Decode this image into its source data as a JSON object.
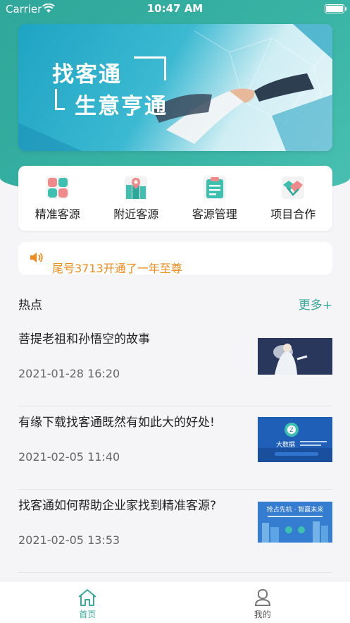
{
  "status_bar": {
    "carrier": "Carrier",
    "time": "10:47 AM"
  },
  "banner": {
    "line1": "找客通",
    "line2": "生意亨通"
  },
  "menu": [
    {
      "label": "精准客源",
      "icon": "grid-icon"
    },
    {
      "label": "附近客源",
      "icon": "map-pin-icon"
    },
    {
      "label": "客源管理",
      "icon": "clipboard-icon"
    },
    {
      "label": "项目合作",
      "icon": "handshake-icon"
    }
  ],
  "notice": {
    "text": "尾号3713开通了一年至尊",
    "icon": "speaker-icon"
  },
  "hot": {
    "title": "热点",
    "more": "更多+"
  },
  "news": [
    {
      "title": "菩提老祖和孙悟空的故事",
      "date": "2021-01-28 16:20"
    },
    {
      "title": "有缘下载找客通既然有如此大的好处!",
      "date": "2021-02-05 11:40",
      "thumb_label": "大数据"
    },
    {
      "title": "找客通如何帮助企业家找到精准客源?",
      "date": "2021-02-05 13:53",
      "thumb_label": "抢占先机 · 智赢未来"
    }
  ],
  "tabbar": {
    "home": "首页",
    "mine": "我的"
  },
  "colors": {
    "accent": "#3aa79b",
    "notice": "#f08a1a",
    "menu_icon_pink": "#f08a8a",
    "menu_icon_teal": "#3ec0b0"
  }
}
